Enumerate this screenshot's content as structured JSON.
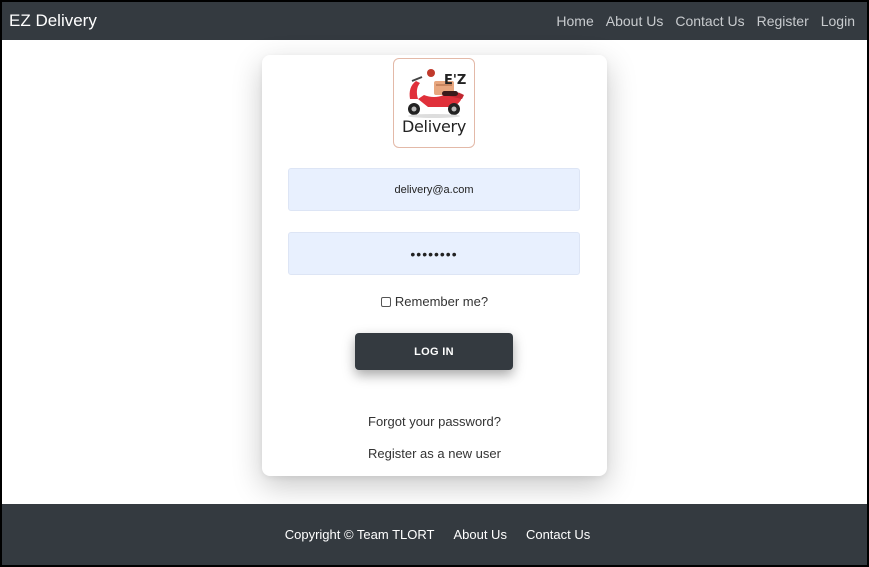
{
  "navbar": {
    "brand": "EZ Delivery",
    "links": [
      "Home",
      "About Us",
      "Contact Us",
      "Register",
      "Login"
    ]
  },
  "logo": {
    "ez": "E'Z",
    "text": "Delivery"
  },
  "login_form": {
    "email_value": "delivery@a.com",
    "password_value": "••••••••",
    "remember_label": "Remember me?",
    "remember_checked": false,
    "login_button": "LOG IN",
    "forgot_link": "Forgot your password?",
    "register_link": "Register as a new user"
  },
  "footer": {
    "copyright": "Copyright © Team TLORT",
    "links": [
      "About Us",
      "Contact Us"
    ]
  },
  "colors": {
    "dark": "#343a40",
    "input_bg": "#e8f0fe",
    "scooter_red": "#e0303a"
  }
}
